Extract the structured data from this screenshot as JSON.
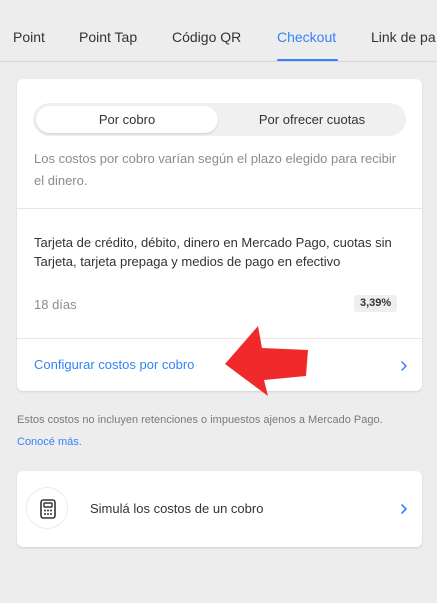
{
  "tabs": [
    {
      "label": "Point"
    },
    {
      "label": "Point Tap"
    },
    {
      "label": "Código QR"
    },
    {
      "label": "Checkout"
    },
    {
      "label": "Link de pa"
    }
  ],
  "active_tab": "Checkout",
  "segmented": {
    "active_label": "Por cobro",
    "inactive_label": "Por ofrecer cuotas"
  },
  "description": "Los costos por cobro varían según el plazo elegido para recibir el dinero.",
  "method": {
    "title": "Tarjeta de crédito, débito, dinero en Mercado Pago, cuotas sin Tarjeta, tarjeta prepaga y medios de pago en efectivo",
    "days": "18 días",
    "rate": "3,39%"
  },
  "config_link": "Configurar costos por cobro",
  "note": {
    "text": "Estos costos no incluyen retenciones o impuestos ajenos a Mercado Pago.",
    "link": "Conocé más."
  },
  "simulate": {
    "label": "Simulá los costos de un cobro",
    "icon": "calculator-icon"
  },
  "colors": {
    "accent": "#3483fa",
    "arrow": "#f02a2a",
    "background": "#ededed"
  }
}
